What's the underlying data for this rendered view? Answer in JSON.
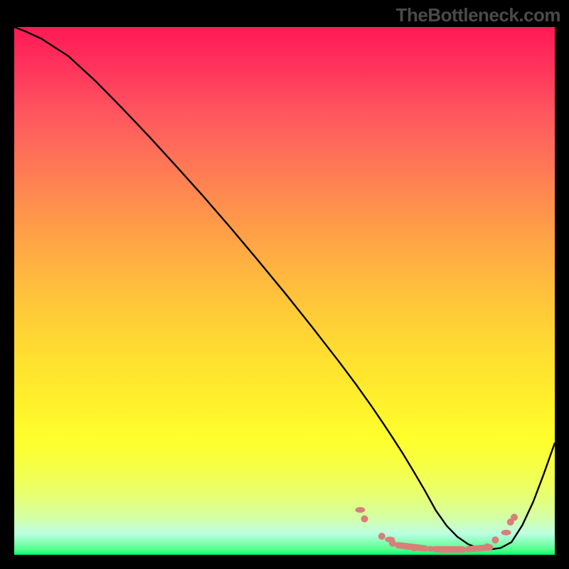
{
  "watermark": "TheBottleneck.com",
  "chart_data": {
    "type": "line",
    "title": "",
    "xlabel": "",
    "ylabel": "",
    "xlim": [
      0,
      100
    ],
    "ylim": [
      0,
      100
    ],
    "background_gradient": {
      "top_color": "#ff1a55",
      "mid_color": "#ffe22f",
      "bottom_color": "#00ff68",
      "meaning": "red=high bottleneck, green=low bottleneck"
    },
    "series": [
      {
        "name": "main-curve",
        "color": "#000000",
        "x": [
          0,
          2,
          5,
          10,
          15,
          20,
          25,
          30,
          35,
          40,
          45,
          50,
          55,
          60,
          63,
          66,
          68,
          70,
          72,
          74,
          76,
          78,
          80,
          82,
          84,
          86,
          88,
          90,
          92,
          94,
          96,
          98,
          100
        ],
        "y": [
          100,
          99.2,
          97.8,
          94.5,
          89.8,
          84.6,
          79.2,
          73.6,
          67.9,
          62.0,
          55.9,
          49.7,
          43.3,
          36.7,
          32.6,
          28.3,
          25.3,
          22.2,
          19.0,
          15.6,
          12.1,
          8.4,
          5.5,
          3.4,
          2.0,
          1.2,
          1.0,
          1.3,
          2.4,
          5.6,
          10.0,
          15.4,
          21.2
        ]
      },
      {
        "name": "dotted-region",
        "color": "#d97f7a",
        "style": "scatter",
        "x": [
          64,
          64.8,
          68,
          69.5,
          70,
          74,
          77,
          80,
          82.5,
          85,
          87.5,
          89,
          91,
          91.8,
          92.5
        ],
        "y": [
          8.5,
          6.8,
          3.5,
          2.9,
          2.2,
          1.3,
          1.1,
          1.0,
          1.0,
          1.1,
          1.5,
          2.8,
          4.2,
          6.2,
          7.1
        ]
      }
    ],
    "annotations": []
  }
}
